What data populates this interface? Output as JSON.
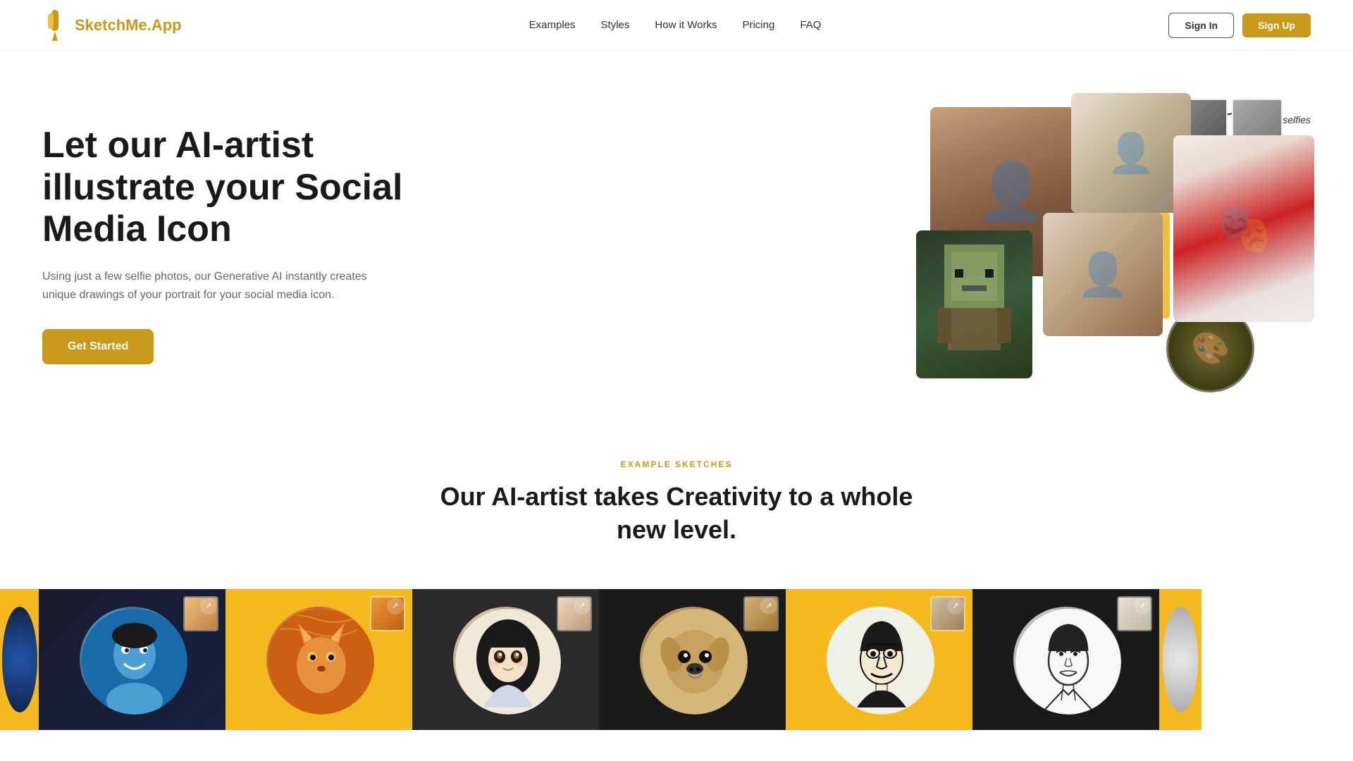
{
  "nav": {
    "logo_text": "SketchMe.App",
    "links": [
      {
        "label": "Examples",
        "href": "#examples"
      },
      {
        "label": "Styles",
        "href": "#styles"
      },
      {
        "label": "How it Works",
        "href": "#how"
      },
      {
        "label": "Pricing",
        "href": "#pricing"
      },
      {
        "label": "FAQ",
        "href": "#faq"
      }
    ],
    "signin_label": "Sign In",
    "signup_label": "Sign Up"
  },
  "hero": {
    "title": "Let our AI-artist illustrate your Social Media Icon",
    "description": "Using just a few selfie photos, our Generative AI instantly creates unique drawings of your portrait for your social media icon.",
    "cta_label": "Get Started",
    "selfie_annotation": "your selfies"
  },
  "examples": {
    "section_label": "EXAMPLE SKETCHES",
    "title_line1": "Our AI-artist takes Creativity to a whole",
    "title_line2": "new level.",
    "items": [
      {
        "style": "Blue cartoon illustration",
        "bg": "dark"
      },
      {
        "style": "Van Gogh fox painting",
        "bg": "yellow"
      },
      {
        "style": "Anime girl sketch",
        "bg": "dark"
      },
      {
        "style": "Minimalist dog",
        "bg": "dark"
      },
      {
        "style": "Bold line portrait",
        "bg": "yellow"
      },
      {
        "style": "B&W line art",
        "bg": "dark"
      }
    ]
  }
}
